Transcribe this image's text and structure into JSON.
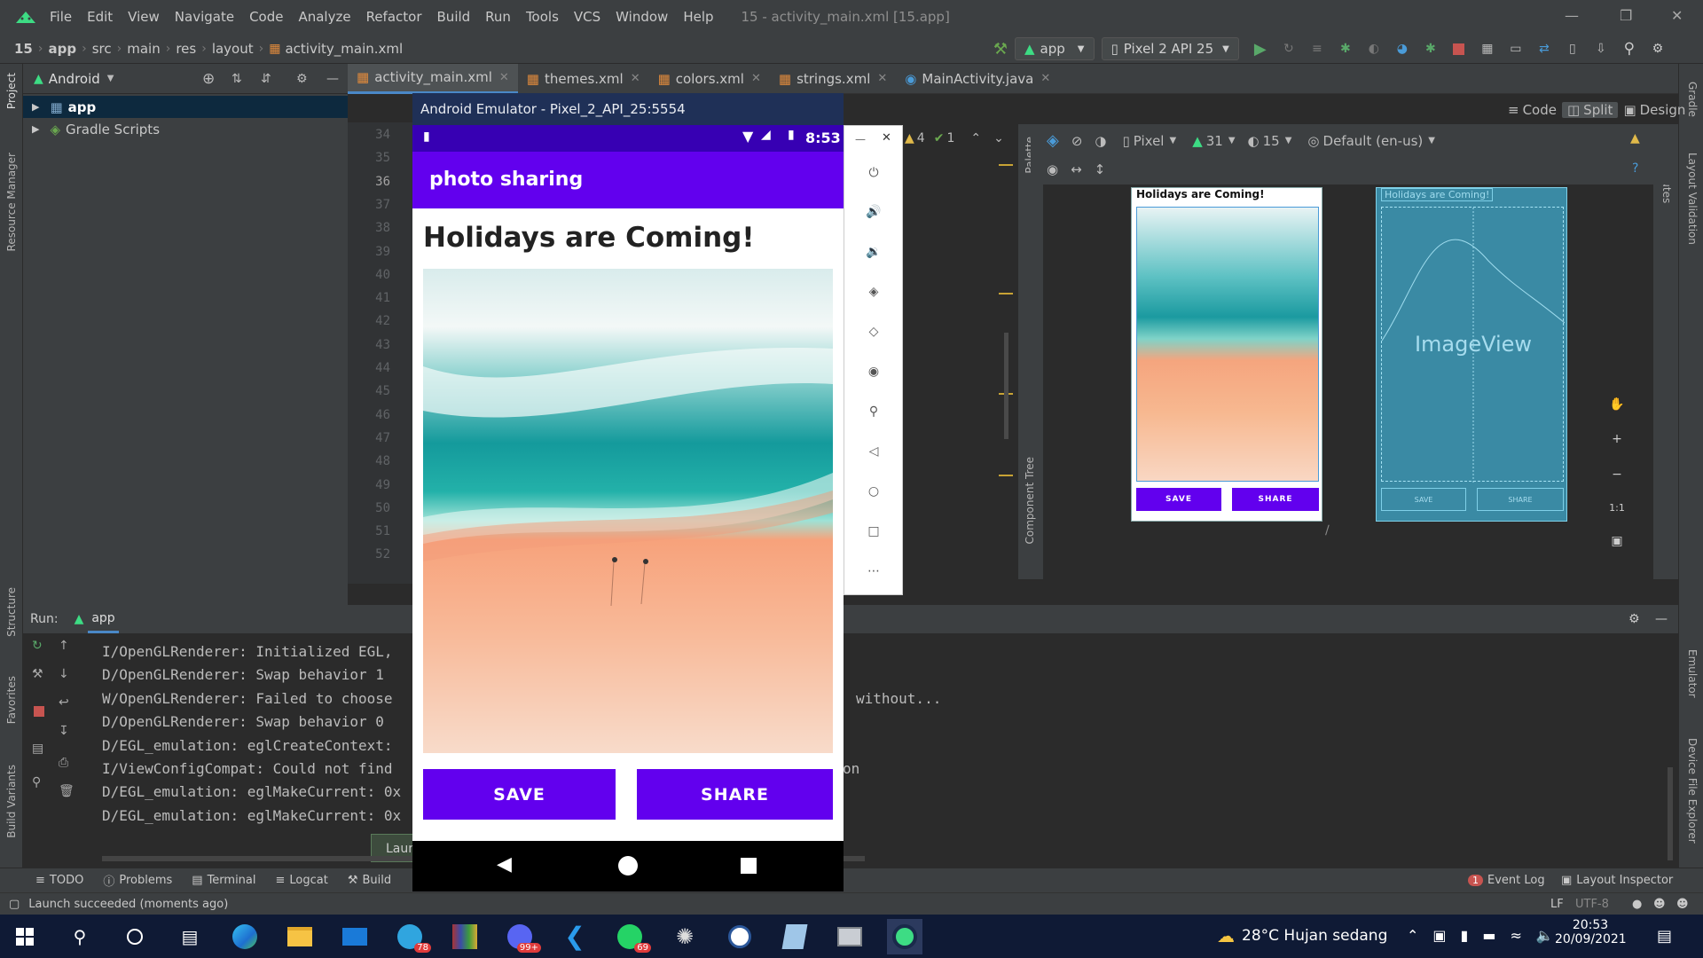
{
  "menubar": {
    "items": [
      "File",
      "Edit",
      "View",
      "Navigate",
      "Code",
      "Analyze",
      "Refactor",
      "Build",
      "Run",
      "Tools",
      "VCS",
      "Window",
      "Help"
    ],
    "title": "15 - activity_main.xml [15.app]"
  },
  "navbar": {
    "crumbs": [
      "15",
      "app",
      "src",
      "main",
      "res",
      "layout",
      "activity_main.xml"
    ],
    "run_config": "app",
    "device": "Pixel 2 API 25"
  },
  "project": {
    "view_label": "Android",
    "items": [
      "app",
      "Gradle Scripts"
    ]
  },
  "left_stripe": [
    "Project",
    "Resource Manager",
    "Structure",
    "Favorites",
    "Build Variants"
  ],
  "right_stripe": [
    "Gradle",
    "Layout Validation",
    "Emulator",
    "Device File Explorer"
  ],
  "tabs": [
    "activity_main.xml",
    "themes.xml",
    "colors.xml",
    "strings.xml",
    "MainActivity.java"
  ],
  "editor": {
    "line_numbers": [
      "34",
      "35",
      "36",
      "37",
      "38",
      "39",
      "40",
      "41",
      "42",
      "43",
      "44",
      "45",
      "46",
      "47",
      "48",
      "49",
      "50",
      "51",
      "52"
    ],
    "warnings": "4",
    "checks": "1"
  },
  "view_modes": [
    "Code",
    "Split",
    "Design"
  ],
  "design_toolbar": {
    "device": "Pixel",
    "api": "31",
    "theme_ver": "15",
    "locale": "Default (en-us)"
  },
  "palette_labels": [
    "Palette",
    "Component Tree",
    "Attributes"
  ],
  "preview": {
    "heading": "Holidays are Coming!",
    "save": "SAVE",
    "share": "SHARE",
    "blueprint_label": "Holidays are Coming!",
    "blueprint_imageview": "ImageView",
    "blueprint_save": "SAVE",
    "blueprint_share": "SHARE"
  },
  "zoom_controls": [
    "1:1"
  ],
  "run_panel": {
    "label": "Run:",
    "config": "app",
    "logs": [
      "I/OpenGLRenderer: Initialized EGL,",
      "D/OpenGLRenderer: Swap behavior 1",
      "W/OpenGLRenderer: Failed to choose",
      "D/OpenGLRenderer: Swap behavior 0",
      "D/EGL_emulation: eglCreateContext:",
      "I/ViewConfigCompat: Could not find",
      "D/EGL_emulation: eglMakeCurrent: 0x",
      "D/EGL_emulation: eglMakeCurrent: 0x"
    ],
    "log_tail_1": "without...",
    "log_tail_2": "on",
    "popup": "Laun"
  },
  "bottom_tools": [
    "TODO",
    "Problems",
    "Terminal",
    "Logcat",
    "Build"
  ],
  "bottom_right": {
    "event_log": "Event Log",
    "event_count": "1",
    "layout_inspector": "Layout Inspector"
  },
  "status": {
    "message": "Launch succeeded (moments ago)",
    "lf": "LF",
    "encoding": "UTF-8"
  },
  "emulator": {
    "title": "Android Emulator - Pixel_2_API_25:5554",
    "time": "8:53",
    "app_title": "photo sharing",
    "heading": "Holidays are Coming!",
    "save": "SAVE",
    "share": "SHARE"
  },
  "taskbar": {
    "weather": "28°C  Hujan sedang",
    "time": "20:53",
    "date": "20/09/2021",
    "badges": [
      "78",
      "99+",
      "69"
    ]
  },
  "colors": {
    "purple": "#6200ee",
    "purple_dark": "#3700b3",
    "ide_bg": "#2b2b2b",
    "ide_panel": "#3c3f41"
  }
}
